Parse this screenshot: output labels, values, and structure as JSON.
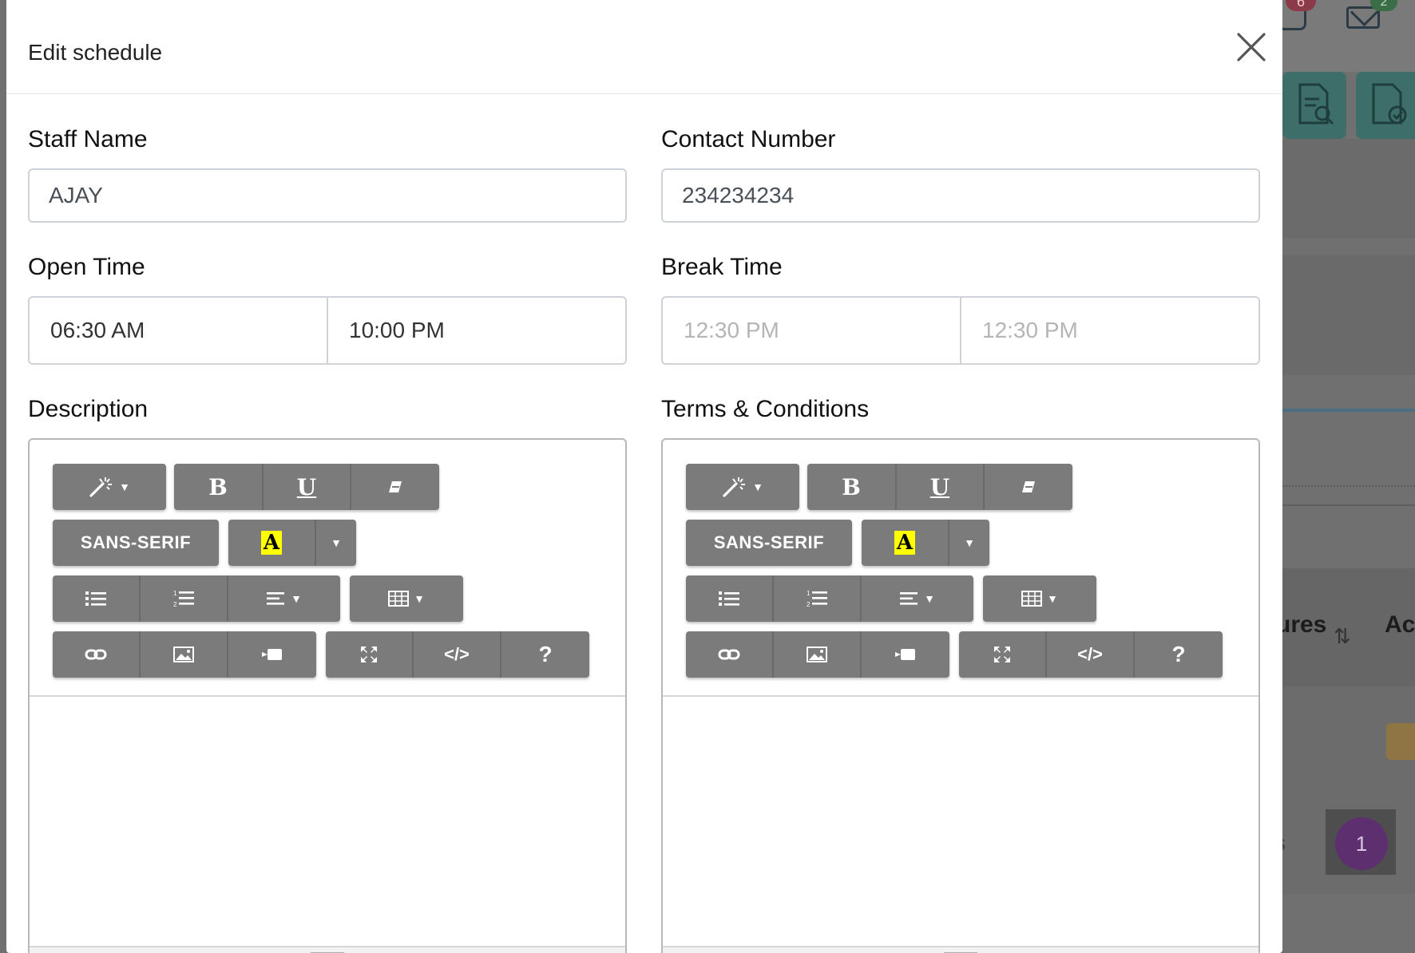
{
  "modal": {
    "title": "Edit schedule",
    "close_icon": "close-icon"
  },
  "form": {
    "staff_name": {
      "label": "Staff Name",
      "value": "AJAY"
    },
    "contact_number": {
      "label": "Contact Number",
      "value": "234234234"
    },
    "open_time": {
      "label": "Open Time",
      "start": "06:30 AM",
      "end": "10:00 PM"
    },
    "break_time": {
      "label": "Break Time",
      "start_placeholder": "12:30 PM",
      "end_placeholder": "12:30 PM"
    },
    "description": {
      "label": "Description"
    },
    "terms": {
      "label": "Terms & Conditions"
    }
  },
  "editor_toolbar": {
    "style_icon": "magic-wand-icon",
    "bold": "B",
    "underline": "U",
    "eraser_icon": "eraser-icon",
    "font_name": "SANS-SERIF",
    "color_letter": "A",
    "ul_icon": "unordered-list-icon",
    "ol_icon": "ordered-list-icon",
    "align_icon": "align-icon",
    "table_icon": "table-icon",
    "link_icon": "link-icon",
    "picture_icon": "picture-icon",
    "video_icon": "video-icon",
    "fullscreen_icon": "fullscreen-icon",
    "code_label": "</>",
    "help_label": "?"
  },
  "background": {
    "bell_badge": "6",
    "mail_badge": "2",
    "column_features": "ures",
    "column_action": "Ac",
    "pagination_current": "1",
    "partial_text": "s"
  },
  "colors": {
    "toolbar_button": "#7b7b7b",
    "color_swatch": "#ffff00",
    "overlay": "#707070",
    "tile": "#3e6e6a"
  }
}
